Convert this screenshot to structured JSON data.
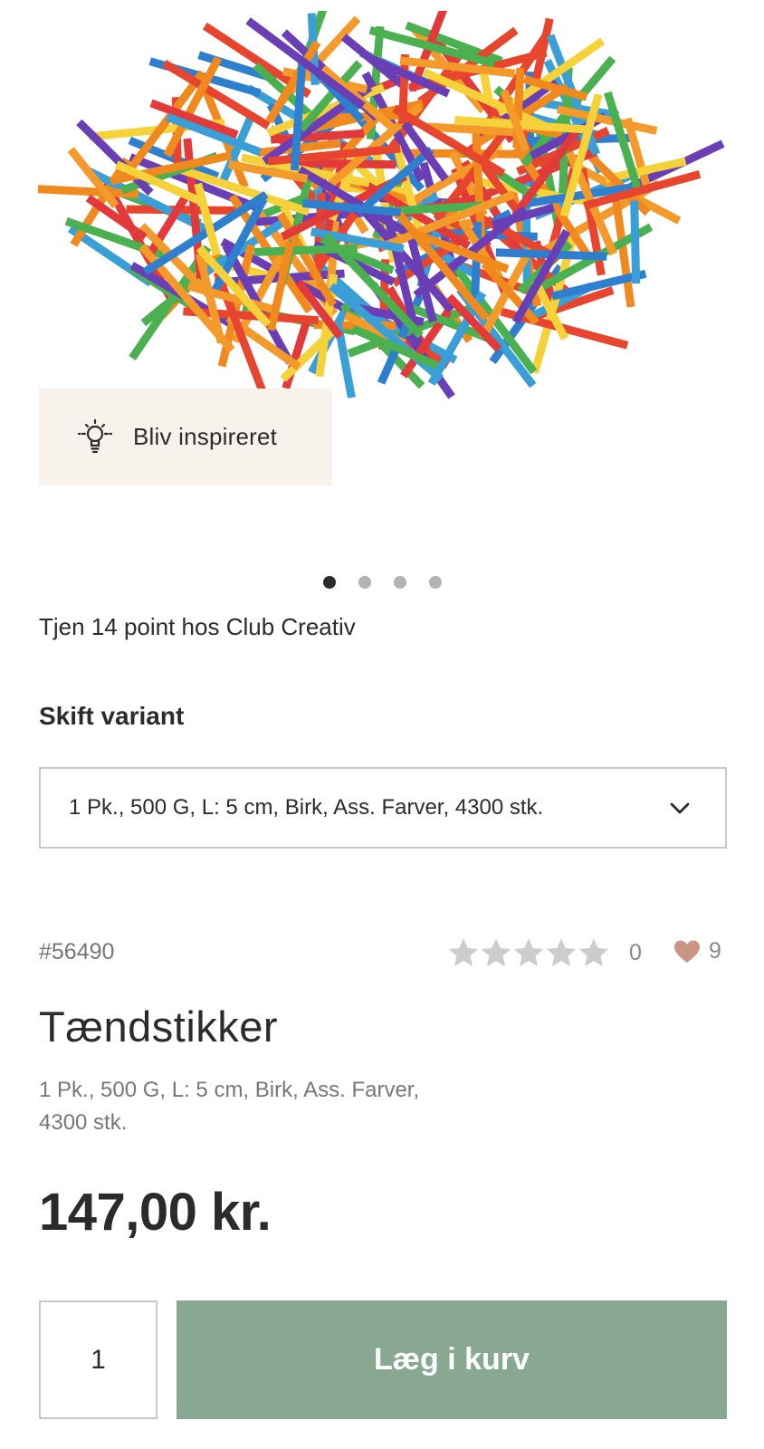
{
  "gallery": {
    "image_alt": "Tændstikker",
    "inspire_label": "Bliv inspireret",
    "inspire_icon": "lightbulb-icon",
    "slides_total": 4,
    "active_slide": 1
  },
  "loyalty": {
    "points_text": "Tjen 14 point hos Club Creativ"
  },
  "variant": {
    "heading": "Skift variant",
    "selected": "1 Pk., 500 G, L: 5 cm, Birk, Ass. Farver, 4300 stk.",
    "icon": "chevron-down-icon"
  },
  "product": {
    "sku": "#56490",
    "rating_count": "0",
    "rating_stars": 0,
    "favorites_count": "9",
    "title": "Tændstikker",
    "subtitle": "1 Pk., 500 G, L: 5 cm, Birk, Ass. Farver, 4300 stk.",
    "price": "147,00 kr."
  },
  "cart": {
    "quantity": "1",
    "add_label": "Læg i kurv"
  },
  "colors": {
    "cart_button": "#88a892",
    "inspire_bg": "#f8f2ed",
    "heart": "#c99585",
    "star_empty": "#cccccc"
  }
}
